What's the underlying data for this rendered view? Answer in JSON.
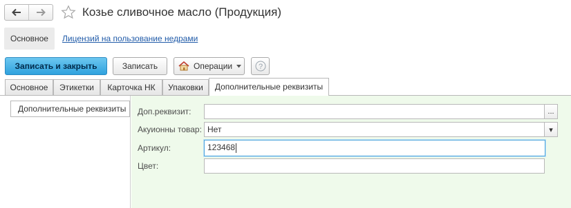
{
  "window": {
    "title": "Козье сливочное масло (Продукция)"
  },
  "nav": {
    "back_icon": "arrow-left-icon",
    "forward_icon": "arrow-right-icon",
    "favorite_icon": "star-icon"
  },
  "sections": [
    {
      "label": "Основное",
      "active": true
    },
    {
      "label": "Лицензий на пользование недрами",
      "active": false
    }
  ],
  "toolbar": {
    "save_close_label": "Записать и закрыть",
    "save_label": "Записать",
    "operations_label": "Операции",
    "help_label": "?"
  },
  "tabs": [
    {
      "label": "Основное"
    },
    {
      "label": "Этикетки"
    },
    {
      "label": "Карточка НК"
    },
    {
      "label": "Упаковки"
    },
    {
      "label": "Дополнительные реквизиты",
      "active": true
    }
  ],
  "left_panel": {
    "item_label": "Дополнительные реквизиты"
  },
  "form": {
    "fields": [
      {
        "label": "Доп.реквизит:",
        "value": "",
        "button": "..."
      },
      {
        "label": "Акуионны товар:",
        "value": "Нет",
        "button": "▾"
      },
      {
        "label": "Артикул:",
        "value": "123468"
      },
      {
        "label": "Цвет:",
        "value": ""
      }
    ]
  },
  "colors": {
    "primary_button": "#2fa2de",
    "link": "#1f5aa8",
    "panel_background": "#effaeb",
    "focus_border": "#4ea6dc"
  }
}
